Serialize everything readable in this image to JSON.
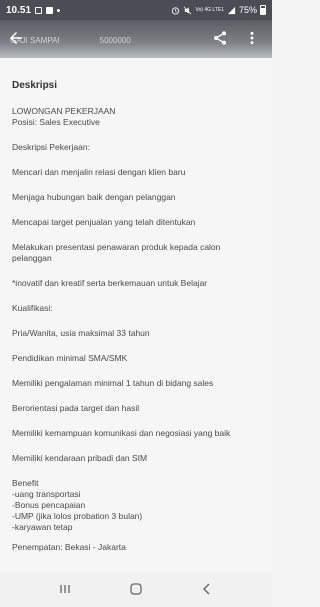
{
  "status": {
    "time": "10.51",
    "battery": "75%",
    "signal_text": "Vo) 4G LTE1"
  },
  "toolbar": {
    "ghost_label": "GAJI SAMPAI",
    "ghost_value": "5000000",
    "icons": [
      "back-arrow-icon",
      "share-icon",
      "more-vert-icon"
    ]
  },
  "content": {
    "section_title": "Deskripsi",
    "heading_line1": "LOWONGAN PEKERJAAN",
    "heading_line2": "Posisi: Sales Executive",
    "job_desc_label": "Deskripsi Pekerjaan:",
    "duties": [
      "Mencari dan menjalin relasi dengan klien baru",
      "Menjaga hubungan baik dengan pelanggan",
      "Mencapai target penjualan yang telah ditentukan",
      "Melakukan presentasi penawaran produk kepada calon pelanggan",
      "*inovatif dan kreatif serta berkemauan untuk Belajar"
    ],
    "qual_label": "Kualifikasi:",
    "qualifications": [
      "Pria/Wanita, usia maksimal 33 tahun",
      "Pendidikan minimal SMA/SMK",
      "Memiliki pengalaman minimal 1 tahun di bidang sales",
      "Berorientasi pada target dan hasil",
      "Memiliki kemampuan komunikasi dan negosiasi yang baik",
      "Memiliki kendaraan pribadi dan SIM"
    ],
    "benefit_label": "Benefit",
    "benefits": [
      "-uang transportasi",
      "-Bonus pencapaian",
      "-UMP (jika lolos probation 3 bulan)",
      "-karyawan tetap"
    ],
    "placement": "Penempatan: Bekasi - Jakarta"
  }
}
